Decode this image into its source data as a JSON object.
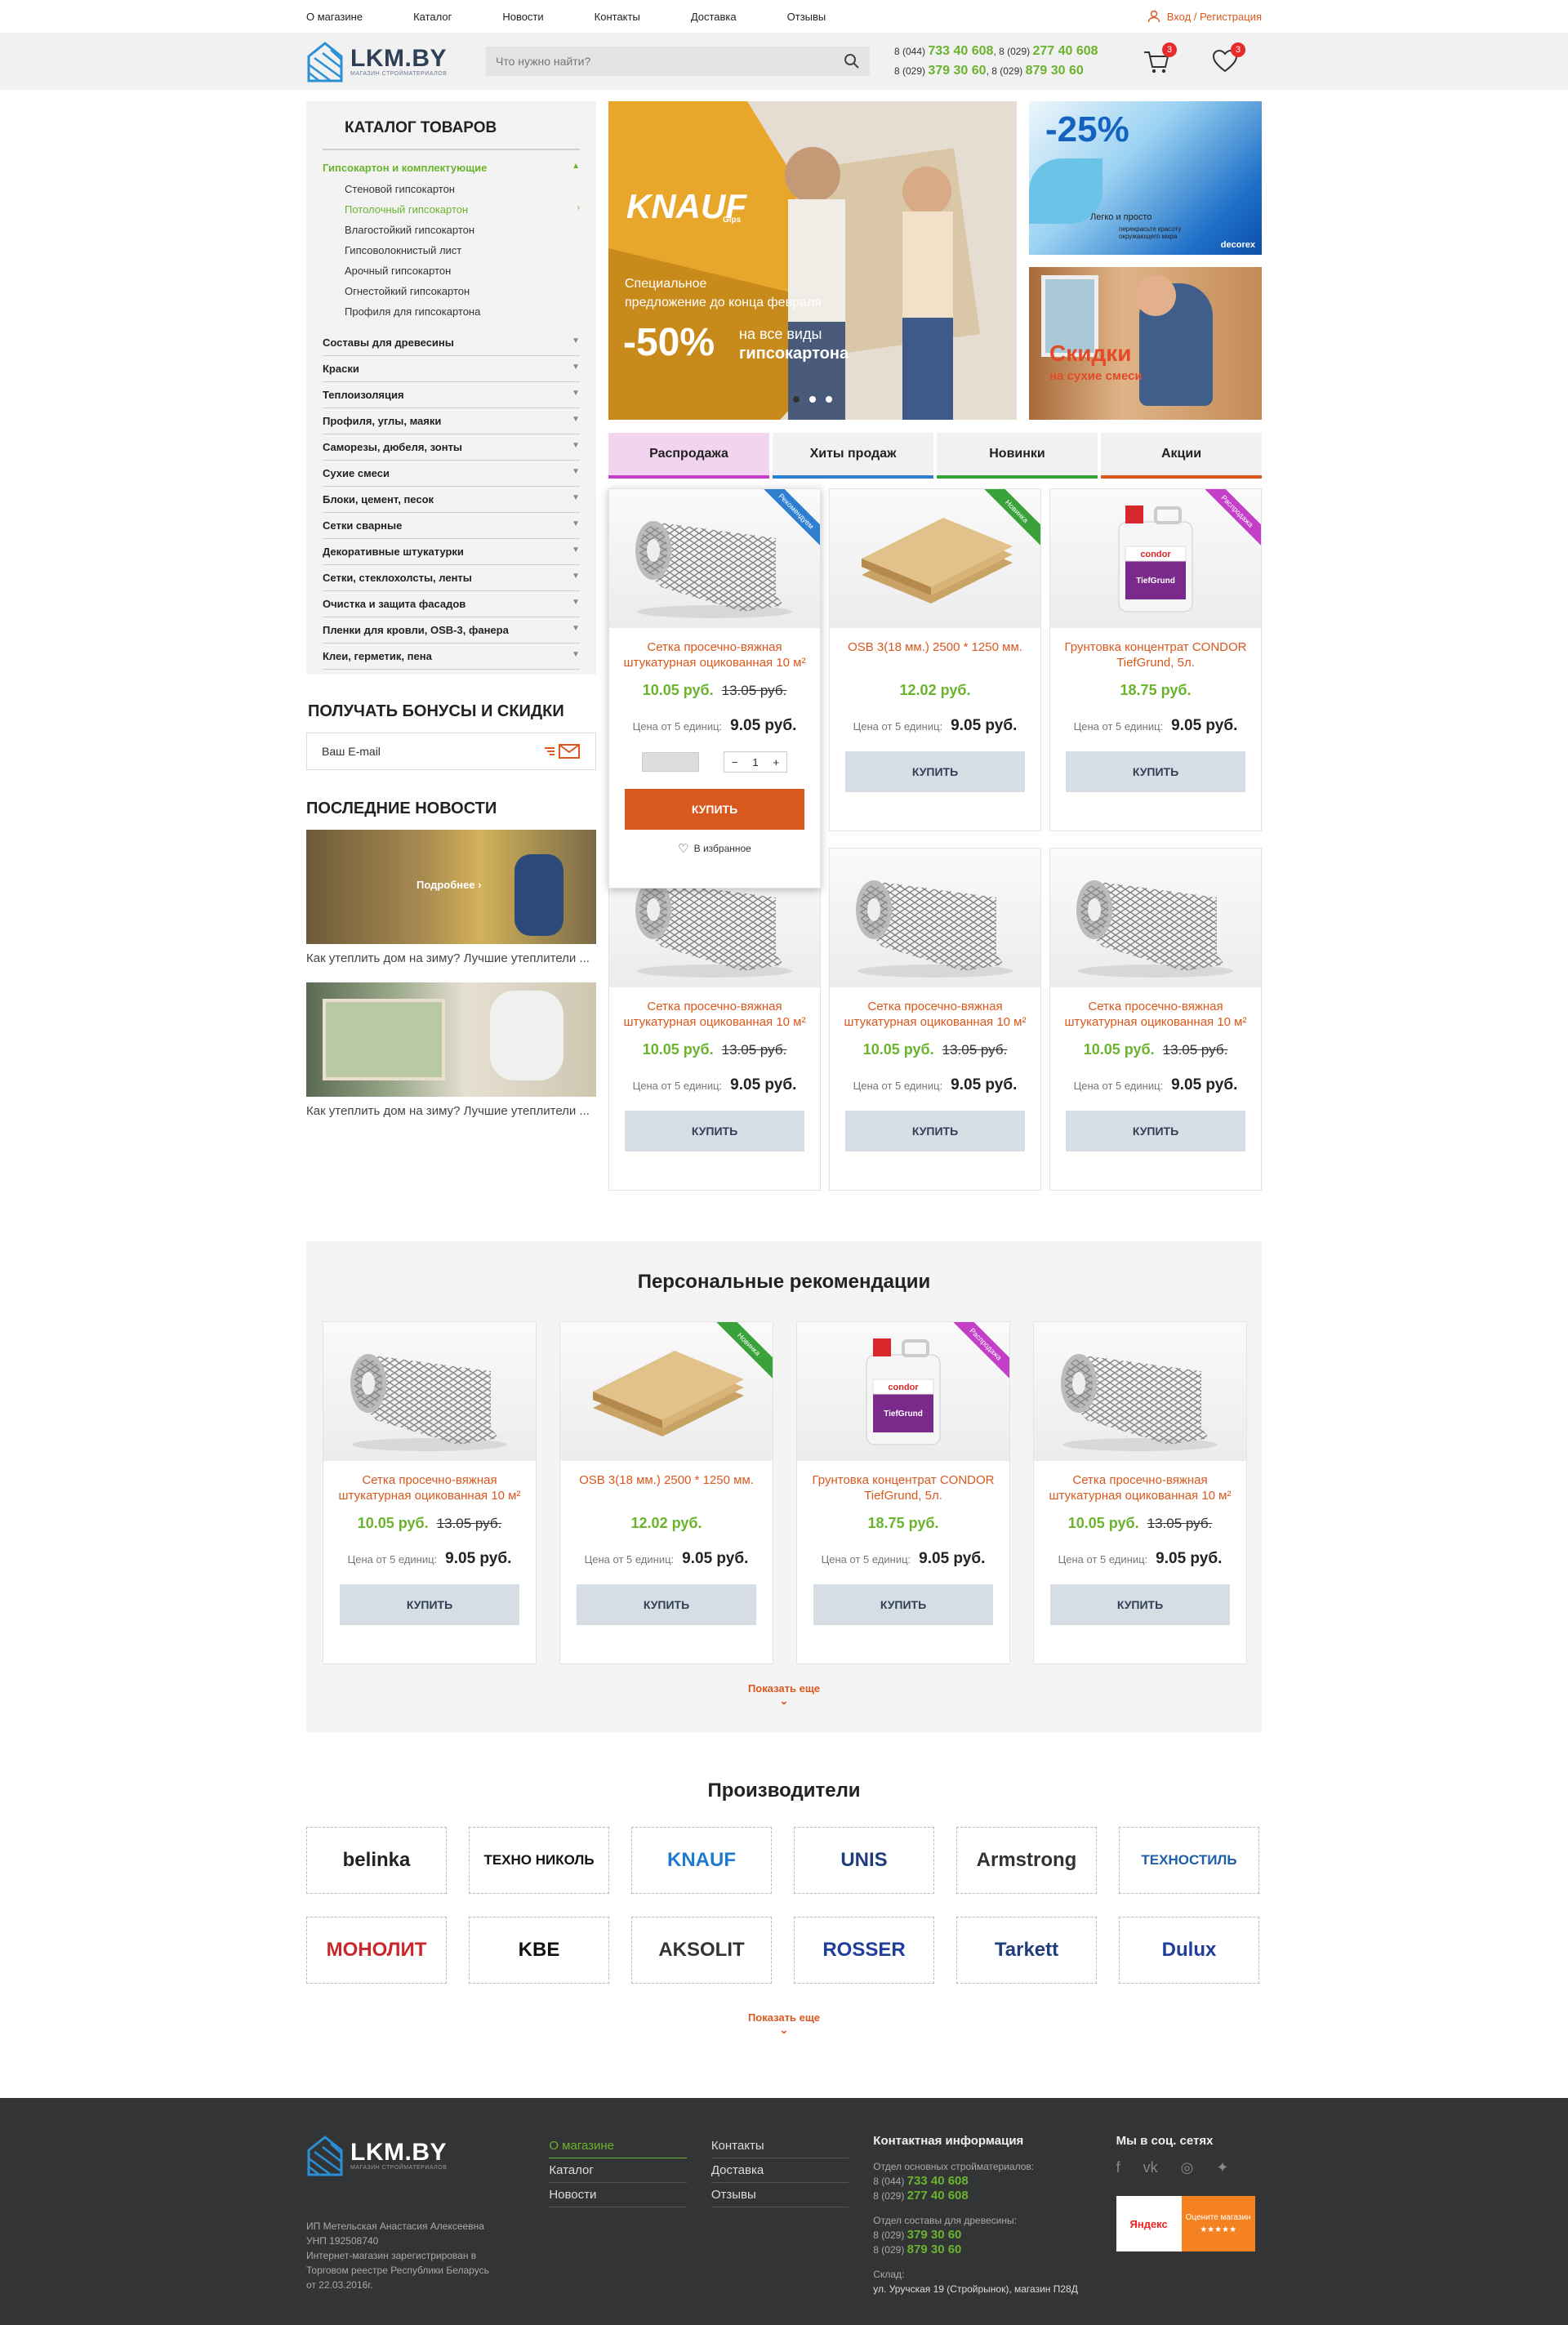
{
  "topnav": {
    "links": [
      "О магазине",
      "Каталог",
      "Новости",
      "Контакты",
      "Доставка",
      "Отзывы"
    ],
    "login": "Вход / Регистрация"
  },
  "header": {
    "logo": "LKM.BY",
    "logo_sub": "МАГАЗИН СТРОЙМАТЕРИАЛОВ",
    "search_placeholder": "Что нужно найти?",
    "phone1_code": "8 (044)",
    "phone1": "733 40 608",
    "phone2_code": "8 (029)",
    "phone2": "277 40 608",
    "phone3_code": "8 (029)",
    "phone3": "379 30 60",
    "phone4_code": "8 (029)",
    "phone4": "879 30 60",
    "cart_count": "3",
    "fav_count": "3"
  },
  "catalog": {
    "title": "КАТАЛОГ ТОВАРОВ",
    "open_category": "Гипсокартон и комплектующие",
    "subitems": [
      "Стеновой гипсокартон",
      "Потолочный гипсокартон",
      "Влагостойкий гипсокартон",
      "Гипсоволокнистый лист",
      "Арочный гипсокартон",
      "Огнестойкий гипсокартон",
      "Профиля для гипсокартона"
    ],
    "categories": [
      "Составы для древесины",
      "Краски",
      "Теплоизоляция",
      "Профиля, углы, маяки",
      "Саморезы, дюбеля, зонты",
      "Сухие смеси",
      "Блоки, цемент, песок",
      "Сетки сварные",
      "Декоративные штукатурки",
      "Сетки, стеклохолсты, ленты",
      "Очистка и защита фасадов",
      "Пленки для кровли, OSB-3, фанера",
      "Клеи, герметик, пена"
    ]
  },
  "bonus": {
    "title": "ПОЛУЧАТЬ БОНУСЫ И СКИДКИ",
    "placeholder": "Ваш E-mail"
  },
  "news": {
    "title": "ПОСЛЕДНИЕ НОВОСТИ",
    "more": "Подробнее",
    "items": [
      "Как утеплить дом на зиму? Лучшие утеплители ...",
      "Как утеплить дом на зиму? Лучшие утеплители ..."
    ]
  },
  "banner": {
    "brand": "KNAUF",
    "brand_sub": "Gips",
    "line1": "Специальное",
    "line2": "предложение до конца февраля",
    "discount": "-50%",
    "line3": "на все виды",
    "line4": "гипсокартона",
    "side1_discount": "-25%",
    "side1_text1": "Легко и просто",
    "side1_text2": "перекрасьте красоту окружающего мира",
    "side1_brand": "decorex",
    "side2_line1": "Скидки",
    "side2_line2": "на сухие смеси"
  },
  "tabs": [
    {
      "label": "Распродажа",
      "color": "#c43fc8"
    },
    {
      "label": "Хиты продаж",
      "color": "#2f7fd1"
    },
    {
      "label": "Новинки",
      "color": "#3aa23a"
    },
    {
      "label": "Акции",
      "color": "#d9581d"
    }
  ],
  "common": {
    "wholesale_label": "Цена от 5 единиц:",
    "buy": "КУПИТЬ",
    "fav": "В избранное",
    "qty": "1",
    "show_more": "Показать еще"
  },
  "products": [
    {
      "name": "Сетка просечно-вяжная штукатурная оцикованная 10 м²",
      "price": "10.05 руб.",
      "old": "13.05 руб.",
      "wholesale": "9.05 руб.",
      "ribbon": "Рекомендуем",
      "ribbon_color": "#2f7fd1",
      "img": "mesh"
    },
    {
      "name": "OSB 3(18 мм.) 2500 * 1250 мм.",
      "price": "12.02 руб.",
      "old": "",
      "wholesale": "9.05 руб.",
      "ribbon": "Новинка",
      "ribbon_color": "#3aa23a",
      "img": "osb"
    },
    {
      "name": "Грунтовка концентрат CONDOR TiefGrund, 5л.",
      "price": "18.75 руб.",
      "old": "",
      "wholesale": "9.05 руб.",
      "ribbon": "Распродажа",
      "ribbon_color": "#c43fc8",
      "img": "canister"
    },
    {
      "name": "Сетка просечно-вяжная штукатурная оцикованная 10 м²",
      "price": "10.05 руб.",
      "old": "13.05 руб.",
      "wholesale": "9.05 руб.",
      "ribbon": "",
      "ribbon_color": "",
      "img": "mesh"
    },
    {
      "name": "Сетка просечно-вяжная штукатурная оцикованная 10 м²",
      "price": "10.05 руб.",
      "old": "13.05 руб.",
      "wholesale": "9.05 руб.",
      "ribbon": "",
      "ribbon_color": "",
      "img": "mesh"
    },
    {
      "name": "Сетка просечно-вяжная штукатурная оцикованная 10 м²",
      "price": "10.05 руб.",
      "old": "13.05 руб.",
      "wholesale": "9.05 руб.",
      "ribbon": "",
      "ribbon_color": "",
      "img": "mesh"
    }
  ],
  "recs": {
    "title": "Персональные рекомендации",
    "items": [
      {
        "name": "Сетка просечно-вяжная штукатурная оцикованная 10 м²",
        "price": "10.05 руб.",
        "old": "13.05 руб.",
        "wholesale": "9.05 руб.",
        "ribbon": "",
        "ribbon_color": "",
        "img": "mesh"
      },
      {
        "name": "OSB 3(18 мм.) 2500 * 1250 мм.",
        "price": "12.02 руб.",
        "old": "",
        "wholesale": "9.05 руб.",
        "ribbon": "Новинка",
        "ribbon_color": "#3aa23a",
        "img": "osb"
      },
      {
        "name": "Грунтовка концентрат CONDOR TiefGrund, 5л.",
        "price": "18.75 руб.",
        "old": "",
        "wholesale": "9.05 руб.",
        "ribbon": "Распродажа",
        "ribbon_color": "#c43fc8",
        "img": "canister"
      },
      {
        "name": "Сетка просечно-вяжная штукатурная оцикованная 10 м²",
        "price": "10.05 руб.",
        "old": "13.05 руб.",
        "wholesale": "9.05 руб.",
        "ribbon": "",
        "ribbon_color": "",
        "img": "mesh"
      }
    ]
  },
  "brands": {
    "title": "Производители",
    "items": [
      {
        "name": "belinka",
        "color": "#222"
      },
      {
        "name": "ТЕХНО НИКОЛЬ",
        "color": "#111"
      },
      {
        "name": "KNAUF",
        "color": "#1f7bd1"
      },
      {
        "name": "UNIS",
        "color": "#1f3d7a"
      },
      {
        "name": "Armstrong",
        "color": "#333"
      },
      {
        "name": "ТЕХНОСТИЛЬ",
        "color": "#1f5fa8"
      },
      {
        "name": "МОНОЛИТ",
        "color": "#c8272b"
      },
      {
        "name": "KBE",
        "color": "#111"
      },
      {
        "name": "AKSOLIT",
        "color": "#333"
      },
      {
        "name": "ROSSER",
        "color": "#1f3d9a"
      },
      {
        "name": "Tarkett",
        "color": "#1f3d7a"
      },
      {
        "name": "Dulux",
        "color": "#1f3d9a"
      }
    ]
  },
  "footer": {
    "logo": "LKM.BY",
    "logo_sub": "МАГАЗИН СТРОЙМАТЕРИАЛОВ",
    "legal1": "ИП Метельская Анастасия Алексеевна",
    "legal2": "УНП 192508740",
    "legal3": "Интернет-магазин зарегистрирован в Торговом реестре Республики Беларусь",
    "legal4": "от 22.03.2016г.",
    "links_col1": [
      "О магазине",
      "Каталог",
      "Новости"
    ],
    "links_col2": [
      "Контакты",
      "Доставка",
      "Отзывы"
    ],
    "contact_title": "Контактная информация",
    "dept1": "Отдел основных стройматериалов:",
    "dept1_p1_code": "8 (044)",
    "dept1_p1": "733 40 608",
    "dept1_p2_code": "8 (029)",
    "dept1_p2": "277 40 608",
    "dept2": "Отдел составы для древесины:",
    "dept2_p1_code": "8 (029)",
    "dept2_p1": "379 30 60",
    "dept2_p2_code": "8 (029)",
    "dept2_p2": "879 30 60",
    "warehouse": "Склад:",
    "address": "ул. Уручская 19 (Стройрынок), магазин П28Д",
    "social_title": "Мы в соц. сетях",
    "yandex": "Яндекс",
    "yandex_text": "Оцените магазин",
    "yandex_stars": "★★★★★"
  }
}
